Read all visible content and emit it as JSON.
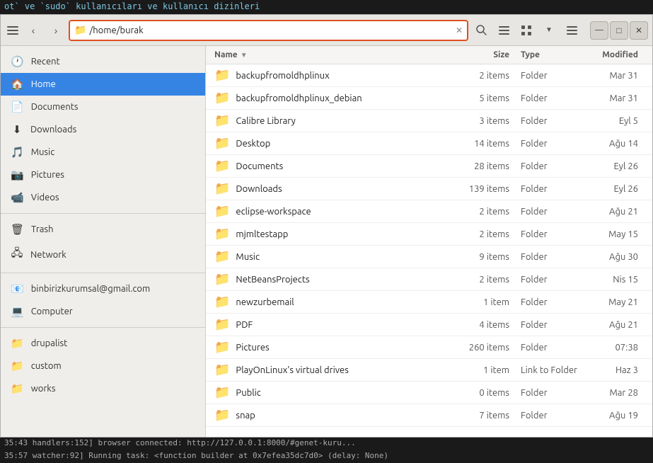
{
  "terminal_top": {
    "text": "ot` ve `sudo` kullanıcıları ve kullanıcı dizinleri"
  },
  "toolbar": {
    "back_label": "‹",
    "forward_label": "›",
    "toggle_label": "☰",
    "location": "/home/burak",
    "location_icon": "📁",
    "clear_icon": "✕",
    "search_icon": "🔍",
    "view_list_icon": "≡",
    "view_grid_icon": "⊞",
    "view_toggle_icon": "▼",
    "menu_icon": "☰",
    "minimize_icon": "—",
    "maximize_icon": "□",
    "close_icon": "✕"
  },
  "sidebar": {
    "items": [
      {
        "id": "recent",
        "label": "Recent",
        "icon": "🕐"
      },
      {
        "id": "home",
        "label": "Home",
        "icon": "🏠",
        "active": true
      },
      {
        "id": "documents",
        "label": "Documents",
        "icon": "📄"
      },
      {
        "id": "downloads",
        "label": "Downloads",
        "icon": "⬇"
      },
      {
        "id": "music",
        "label": "Music",
        "icon": "🎵"
      },
      {
        "id": "pictures",
        "label": "Pictures",
        "icon": "📷"
      },
      {
        "id": "videos",
        "label": "Videos",
        "icon": "📹"
      },
      {
        "id": "trash",
        "label": "Trash",
        "icon": "🗑"
      },
      {
        "id": "network",
        "label": "Network",
        "icon": "🖧"
      },
      {
        "id": "email",
        "label": "binbirizkurumsal@gmail.com",
        "icon": "📧"
      },
      {
        "id": "computer",
        "label": "Computer",
        "icon": "💻"
      },
      {
        "id": "drupalist",
        "label": "drupalist",
        "icon": "📁"
      },
      {
        "id": "custom",
        "label": "custom",
        "icon": "📁"
      },
      {
        "id": "works",
        "label": "works",
        "icon": "📁"
      }
    ]
  },
  "file_list": {
    "columns": {
      "name": "Name",
      "size": "Size",
      "type": "Type",
      "modified": "Modified"
    },
    "rows": [
      {
        "name": "backupfromoldhplinux",
        "size": "2 items",
        "type": "Folder",
        "modified": "Mar 31"
      },
      {
        "name": "backupfromoldhplinux_debian",
        "size": "5 items",
        "type": "Folder",
        "modified": "Mar 31"
      },
      {
        "name": "Calibre Library",
        "size": "3 items",
        "type": "Folder",
        "modified": "Eyl 5"
      },
      {
        "name": "Desktop",
        "size": "14 items",
        "type": "Folder",
        "modified": "Ağu 14"
      },
      {
        "name": "Documents",
        "size": "28 items",
        "type": "Folder",
        "modified": "Eyl 26"
      },
      {
        "name": "Downloads",
        "size": "139 items",
        "type": "Folder",
        "modified": "Eyl 26"
      },
      {
        "name": "eclipse-workspace",
        "size": "2 items",
        "type": "Folder",
        "modified": "Ağu 21"
      },
      {
        "name": "mjmltestapp",
        "size": "2 items",
        "type": "Folder",
        "modified": "May 15"
      },
      {
        "name": "Music",
        "size": "9 items",
        "type": "Folder",
        "modified": "Ağu 30"
      },
      {
        "name": "NetBeansProjects",
        "size": "2 items",
        "type": "Folder",
        "modified": "Nis 15"
      },
      {
        "name": "newzurbemail",
        "size": "1 item",
        "type": "Folder",
        "modified": "May 21"
      },
      {
        "name": "PDF",
        "size": "4 items",
        "type": "Folder",
        "modified": "Ağu 21"
      },
      {
        "name": "Pictures",
        "size": "260 items",
        "type": "Folder",
        "modified": "07:38"
      },
      {
        "name": "PlayOnLinux's virtual drives",
        "size": "1 item",
        "type": "Link to Folder",
        "modified": "Haz 3"
      },
      {
        "name": "Public",
        "size": "0 items",
        "type": "Folder",
        "modified": "Mar 28"
      },
      {
        "name": "snap",
        "size": "7 items",
        "type": "Folder",
        "modified": "Ağu 19"
      }
    ]
  },
  "terminal_bottom1": {
    "text": "35:43 handlers:152] browser connected: http://127.0.0.1:8000/#genet-kuru..."
  },
  "terminal_bottom2": {
    "text": "35:57 watcher:92] Running task: <function builder at 0x7efea35dc7d0> (delay: None)"
  }
}
